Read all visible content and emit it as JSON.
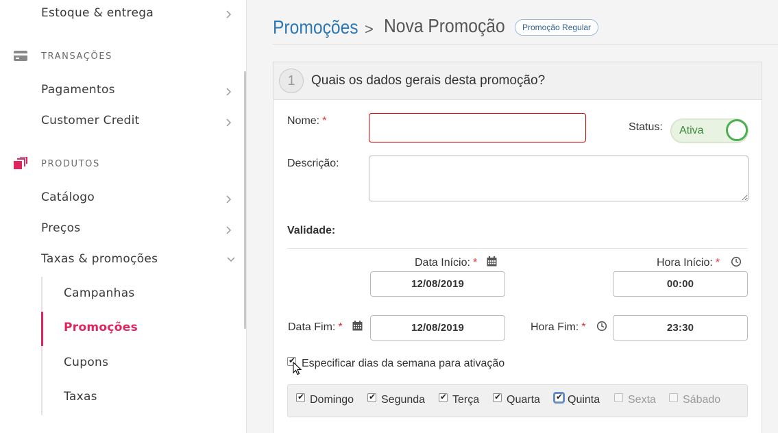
{
  "sidebar": {
    "items_top": [
      {
        "label": "Estoque & entrega"
      }
    ],
    "transacoes": {
      "section": "TRANSAÇÕES",
      "items": [
        {
          "label": "Pagamentos"
        },
        {
          "label": "Customer Credit"
        }
      ]
    },
    "produtos": {
      "section": "PRODUTOS",
      "items": [
        {
          "label": "Catálogo"
        },
        {
          "label": "Preços"
        },
        {
          "label": "Taxas & promoções"
        }
      ],
      "subitems": [
        {
          "label": "Campanhas"
        },
        {
          "label": "Promoções"
        },
        {
          "label": "Cupons"
        },
        {
          "label": "Taxas"
        }
      ],
      "active_subitem": "Promoções"
    },
    "accent_color": "#e0245e"
  },
  "header": {
    "root": "Promoções",
    "separator": ">",
    "current": "Nova Promoção",
    "badge": "Promoção Regular"
  },
  "section1": {
    "step": "1",
    "title": "Quais os dados gerais desta promoção?",
    "nome_label": "Nome:",
    "required_mark": "*",
    "nome_value": "",
    "status_label": "Status:",
    "status_value": "Ativa",
    "descricao_label": "Descrição:",
    "descricao_value": "",
    "validade_title": "Validade:",
    "data_inicio_label": "Data Início:",
    "data_inicio_value": "12/08/2019",
    "hora_inicio_label": "Hora Início:",
    "hora_inicio_value": "00:00",
    "data_fim_label": "Data Fim:",
    "data_fim_value": "12/08/2019",
    "hora_fim_label": "Hora Fim:",
    "hora_fim_value": "23:30",
    "especificar_dias_label": "Especificar dias da semana para ativação",
    "especificar_dias_checked": true,
    "days": [
      {
        "label": "Domingo",
        "checked": true,
        "enabled": true
      },
      {
        "label": "Segunda",
        "checked": true,
        "enabled": true
      },
      {
        "label": "Terça",
        "checked": true,
        "enabled": true
      },
      {
        "label": "Quarta",
        "checked": true,
        "enabled": true
      },
      {
        "label": "Quinta",
        "checked": true,
        "enabled": true
      },
      {
        "label": "Sexta",
        "checked": false,
        "enabled": false
      },
      {
        "label": "Sábado",
        "checked": false,
        "enabled": false
      }
    ]
  },
  "colors": {
    "link_blue": "#2e77b3",
    "toggle_green": "#4caf50",
    "error_red": "#d00"
  }
}
